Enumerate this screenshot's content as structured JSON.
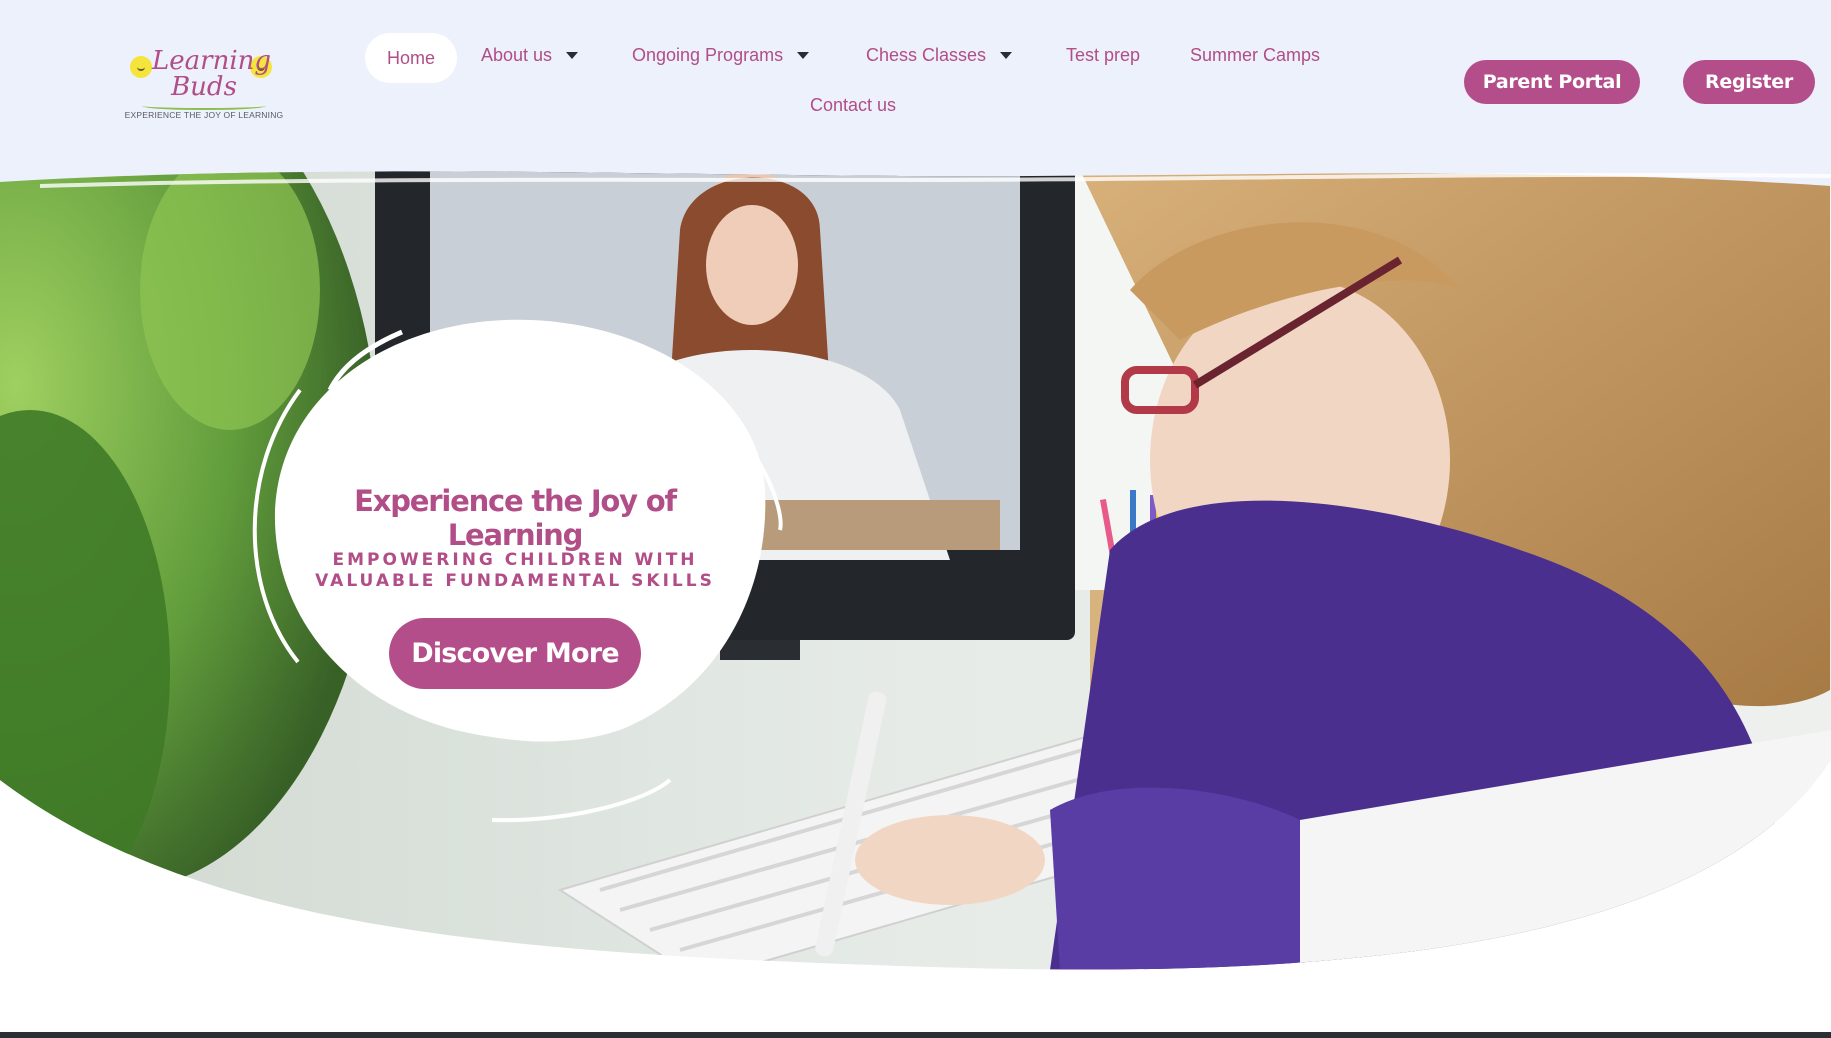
{
  "logo": {
    "line1": "Learning",
    "line2": "Buds",
    "tagline": "EXPERIENCE THE JOY OF LEARNING"
  },
  "nav": {
    "home": "Home",
    "about": "About us",
    "programs": "Ongoing Programs",
    "chess": "Chess Classes",
    "testprep": "Test prep",
    "camps": "Summer Camps",
    "contact": "Contact us"
  },
  "actions": {
    "parent_portal": "Parent Portal",
    "register": "Register"
  },
  "hero": {
    "title": "Experience the Joy of Learning",
    "subtitle_line1": "EMPOWERING CHILDREN WITH",
    "subtitle_line2": "VALUABLE FUNDAMENTAL SKILLS",
    "cta": "Discover More"
  },
  "colors": {
    "brand": "#b44e8a",
    "header_bg": "#edf1fb",
    "sweater": "#4b2f8f"
  },
  "icons": {
    "dropdown": "caret-down-icon"
  }
}
